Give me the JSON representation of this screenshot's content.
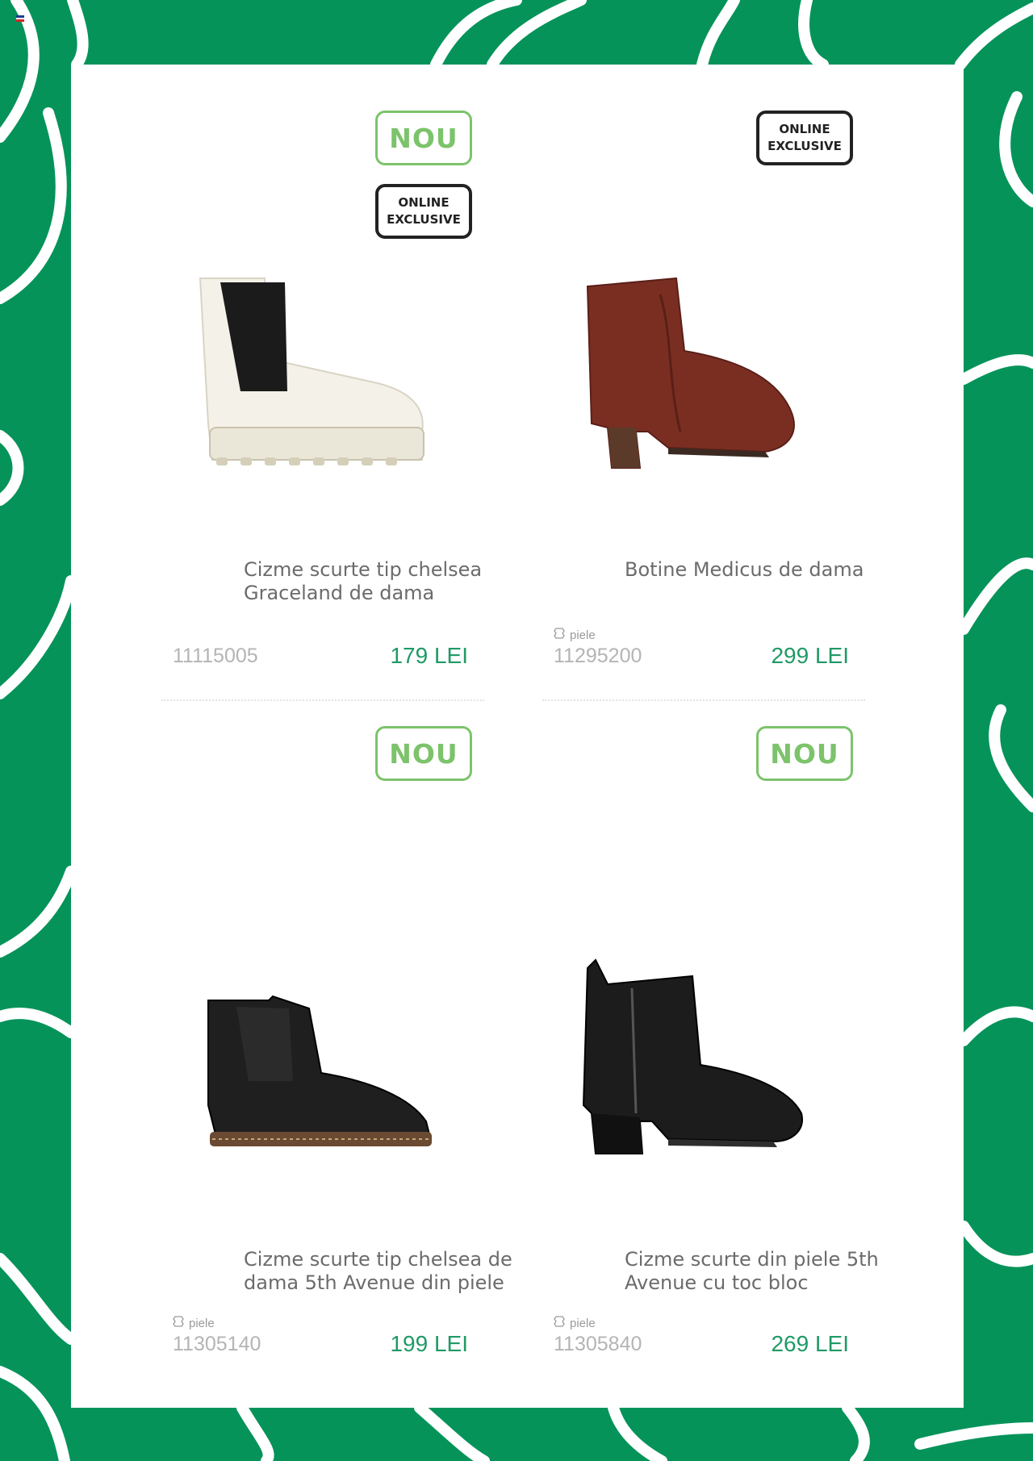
{
  "page": {
    "colors": {
      "background": "#05935a",
      "panel": "#ffffff",
      "badge_new": "#7cc36b",
      "price": "#1f9a66"
    }
  },
  "products": [
    {
      "title": "Cizme scurte tip chelsea Graceland de dama",
      "material": "",
      "code": "11115005",
      "price": "179 LEI",
      "badges": [
        "NOU",
        "ONLINE\nEXCLUSIVE"
      ],
      "image": "white-chelsea-boot"
    },
    {
      "title": "Botine Medicus de dama",
      "material": "piele",
      "code": "11295200",
      "price": "299 LEI",
      "badges": [
        "ONLINE\nEXCLUSIVE"
      ],
      "image": "brown-heeled-bootie"
    },
    {
      "title": "Cizme scurte tip chelsea de dama 5th Avenue din piele",
      "material": "piele",
      "code": "11305140",
      "price": "199 LEI",
      "badges": [
        "NOU"
      ],
      "image": "black-chelsea-boot"
    },
    {
      "title": "Cizme scurte din piele 5th Avenue cu toc bloc",
      "material": "piele",
      "code": "11305840",
      "price": "269 LEI",
      "badges": [
        "NOU"
      ],
      "image": "black-block-heel-boot"
    }
  ]
}
